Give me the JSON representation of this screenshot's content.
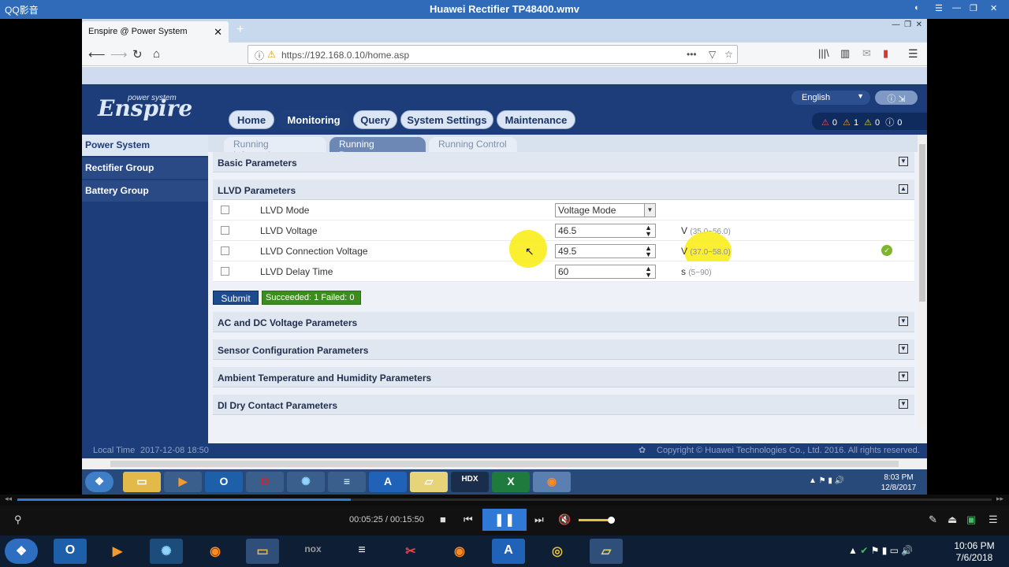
{
  "player": {
    "app_name": "QQ影音",
    "title": "Huawei Rectifier TP48400.wmv",
    "time": "00:05:25 / 00:15:50",
    "progress": 0.342,
    "controls": [
      "pin-icon",
      "stop-icon",
      "prev-icon",
      "pause-icon",
      "next-icon",
      "mute-icon"
    ]
  },
  "browser": {
    "tab_title": "Enspire @ Power System",
    "url": "https://192.168.0.10/home.asp"
  },
  "app": {
    "brand": "Enspire",
    "brand_tag": "power system",
    "language": "English",
    "alarms": [
      "0",
      "1",
      "0",
      "0"
    ],
    "menu": [
      "Home",
      "Monitoring",
      "Query",
      "System Settings",
      "Maintenance"
    ],
    "active_menu": "Monitoring",
    "sidebar": [
      "Power System",
      "Rectifier Group",
      "Battery Group"
    ],
    "subtabs": [
      "Running Information",
      "Running Parameter",
      "Running Control"
    ],
    "sections": {
      "basic": "Basic Parameters",
      "llvd": "LLVD Parameters",
      "acdc": "AC and DC Voltage Parameters",
      "sensor": "Sensor Configuration Parameters",
      "ambient": "Ambient Temperature and Humidity Parameters",
      "di": "DI Dry Contact Parameters"
    },
    "llvd_rows": [
      {
        "name": "LLVD Mode",
        "value": "Voltage Mode",
        "unit": "",
        "range": ""
      },
      {
        "name": "LLVD Voltage",
        "value": "46.5",
        "unit": "V",
        "range": "(35.0~56.0)"
      },
      {
        "name": "LLVD Connection Voltage",
        "value": "49.5",
        "unit": "V",
        "range": "(37.0~58.0)"
      },
      {
        "name": "LLVD Delay Time",
        "value": "60",
        "unit": "s",
        "range": "(5~90)"
      }
    ],
    "submit_label": "Submit",
    "result": "Succeeded: 1  Failed: 0",
    "local_time_label": "Local Time",
    "local_time": "2017-12-08 18:50",
    "copyright": "Copyright © Huawei Technologies Co., Ltd. 2016. All rights reserved."
  },
  "inner_clock": {
    "time": "8:03 PM",
    "date": "12/8/2017"
  },
  "os_clock": {
    "time": "10:06 PM",
    "date": "7/6/2018"
  }
}
